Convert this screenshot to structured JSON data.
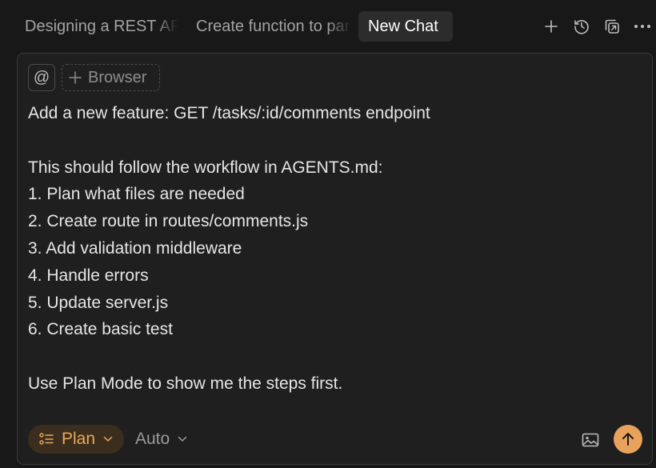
{
  "tabs": [
    {
      "label": "Designing a REST API"
    },
    {
      "label": "Create function to parse"
    },
    {
      "label": "New Chat"
    }
  ],
  "toolbar_icons": [
    "plus-icon",
    "history-icon",
    "copy-icon",
    "more-icon"
  ],
  "composer": {
    "mention_symbol": "@",
    "browser_label": "Browser",
    "prompt_lines": [
      "Add a new feature: GET /tasks/:id/comments endpoint",
      "",
      "This should follow the workflow in AGENTS.md:",
      "1. Plan what files are needed",
      "2. Create route in routes/comments.js",
      "3. Add validation middleware",
      "4. Handle errors",
      "5. Update server.js",
      "6. Create basic test",
      "",
      "Use Plan Mode to show me the steps first."
    ],
    "mode_label": "Plan",
    "model_label": "Auto"
  },
  "colors": {
    "background": "#181818",
    "composer_bg": "#1f1f1f",
    "accent": "#e9a25c",
    "plan_pill_bg": "#3b2e1e"
  }
}
